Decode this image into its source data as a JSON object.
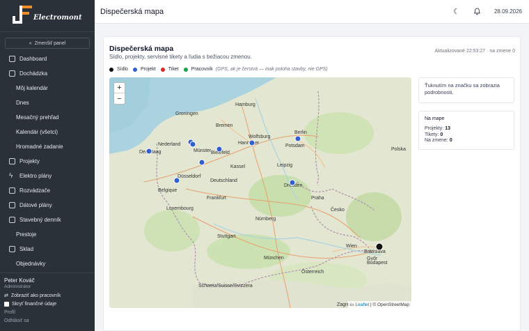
{
  "brand": {
    "name": "Electromont"
  },
  "sidebar": {
    "collapse_label": "Zmenšiť panel",
    "items": [
      {
        "label": "Dashboard",
        "icon": "home-icon"
      },
      {
        "label": "Dochádzka",
        "icon": "calendar-icon"
      },
      {
        "label": "Môj kalendár",
        "sub": true
      },
      {
        "label": "Dnes",
        "sub": true
      },
      {
        "label": "Mesačný prehľad",
        "sub": true
      },
      {
        "label": "Kalendár (všetci)",
        "sub": true
      },
      {
        "label": "Hromadné zadanie",
        "sub": true
      },
      {
        "label": "Projekty",
        "icon": "clipboard-icon"
      },
      {
        "label": "Elektro plány",
        "icon": "bolt-icon"
      },
      {
        "label": "Rozvádzače",
        "icon": "panel-icon"
      },
      {
        "label": "Dátové plány",
        "icon": "database-icon"
      },
      {
        "label": "Stavebný denník",
        "icon": "book-icon"
      },
      {
        "label": "Prestoje",
        "sub": true
      },
      {
        "label": "Sklad",
        "icon": "box-icon"
      },
      {
        "label": "Objednávky",
        "sub": true
      }
    ],
    "user": {
      "name": "Peter Kováč",
      "role": "Administrátor",
      "switch_label": "Zobraziť ako pracovník",
      "hide_finance_label": "Skryť finančné údaje",
      "profile_label": "Profil",
      "logout_label": "Odhlásiť sa"
    }
  },
  "topbar": {
    "title": "Dispečerská mapa",
    "date": "28.09.2026"
  },
  "page": {
    "title": "Dispečerská mapa",
    "subtitle": "Sídlo, projekty, servisné tikety a ľudia s bežiacou zmenou.",
    "updated": "Aktualizované 22:53:27 · na zmene 0",
    "legend": {
      "sidlo": "Sídlo",
      "projekt": "Projekt",
      "tiket": "Tiket",
      "pracovnik": "Pracovník",
      "note": "(GPS, ak je čerstvá — inak poloha stavby, nie GPS)"
    },
    "colors": {
      "sidlo": "#111111",
      "projekt": "#2f5fd0",
      "tiket": "#dc2626",
      "pracovnik": "#16a34a"
    }
  },
  "map": {
    "zoom_in": "+",
    "zoom_out": "−",
    "attribution_leaflet": "Leaflet",
    "attribution_osm": "| © OpenStreetMap",
    "cities": [
      {
        "name": "Hamburg"
      },
      {
        "name": "Groningen"
      },
      {
        "name": "Bremen"
      },
      {
        "name": "Hannover"
      },
      {
        "name": "Wolfsburg"
      },
      {
        "name": "Berlin"
      },
      {
        "name": "Potsdam"
      },
      {
        "name": "Bielefeld"
      },
      {
        "name": "Münster"
      },
      {
        "name": "Den Haag"
      },
      {
        "name": "Nederland"
      },
      {
        "name": "Düsseldorf"
      },
      {
        "name": "Kassel"
      },
      {
        "name": "Leipzig"
      },
      {
        "name": "Dresden"
      },
      {
        "name": "Deutschland"
      },
      {
        "name": "Belgique"
      },
      {
        "name": "Luxembourg"
      },
      {
        "name": "Frankfurt"
      },
      {
        "name": "Praha"
      },
      {
        "name": "Česko"
      },
      {
        "name": "Nürnberg"
      },
      {
        "name": "Stuttgart"
      },
      {
        "name": "München"
      },
      {
        "name": "Wien"
      },
      {
        "name": "Bratislava"
      },
      {
        "name": "Budapest"
      },
      {
        "name": "Österreich"
      },
      {
        "name": "Schweiz/Suisse/Svizzera"
      },
      {
        "name": "Zagreb"
      },
      {
        "name": "Győr"
      },
      {
        "name": "Polska"
      }
    ]
  },
  "info": {
    "text": "Ťuknutím na značku sa zobrazia podrobnosti."
  },
  "stats": {
    "title": "Na mape",
    "projekty_label": "Projekty:",
    "projekty": "13",
    "tikety_label": "Tikety:",
    "tikety": "0",
    "zmene_label": "Na zmene:",
    "zmene": "0"
  }
}
